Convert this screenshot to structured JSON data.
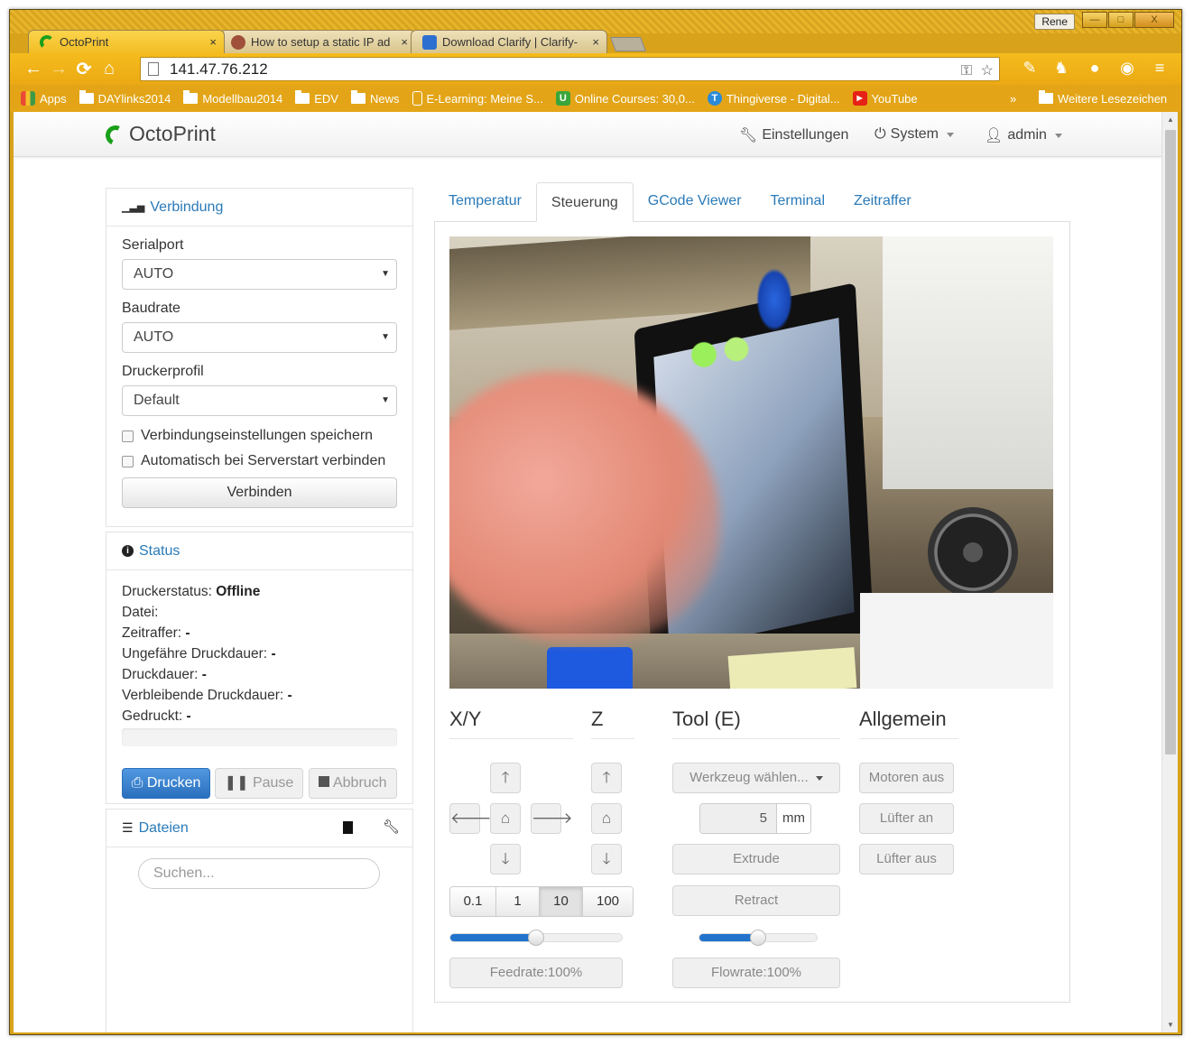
{
  "window": {
    "user": "Rene",
    "min": "—",
    "max": "□",
    "close": "X"
  },
  "browser_tabs": [
    {
      "label": "OctoPrint",
      "close": "×",
      "fav_color": "#1aa01a",
      "active": true
    },
    {
      "label": "How to setup a static IP ad",
      "close": "×",
      "fav_color": "#a0503a",
      "active": false
    },
    {
      "label": "Download Clarify | Clarify-",
      "close": "×",
      "fav_color": "#2d6fd0",
      "active": false
    }
  ],
  "omnibox": {
    "url": "141.47.76.212"
  },
  "bookmarks": [
    {
      "label": "Apps",
      "icon": "apps-grid-icon"
    },
    {
      "label": "DAYlinks2014",
      "icon": "folder-icon"
    },
    {
      "label": "Modellbau2014",
      "icon": "folder-icon"
    },
    {
      "label": "EDV",
      "icon": "folder-icon"
    },
    {
      "label": "News",
      "icon": "folder-icon"
    },
    {
      "label": "E-Learning: Meine S...",
      "icon": "page-icon"
    },
    {
      "label": "Online Courses: 30,0...",
      "icon": "udemy-icon"
    },
    {
      "label": "Thingiverse - Digital...",
      "icon": "thingiverse-icon"
    },
    {
      "label": "YouTube",
      "icon": "youtube-icon"
    }
  ],
  "bookmarks_more": "»",
  "bookmarks_other": "Weitere Lesezeichen",
  "app": {
    "brand": "OctoPrint",
    "nav": {
      "settings": "Einstellungen",
      "system": "System",
      "user": "admin"
    }
  },
  "connection": {
    "title": "Verbindung",
    "serialport_label": "Serialport",
    "serialport_value": "AUTO",
    "baudrate_label": "Baudrate",
    "baudrate_value": "AUTO",
    "profile_label": "Druckerprofil",
    "profile_value": "Default",
    "save_settings": "Verbindungseinstellungen speichern",
    "auto_connect": "Automatisch bei Serverstart verbinden",
    "connect_button": "Verbinden"
  },
  "status": {
    "title": "Status",
    "printer_status_label": "Druckerstatus:",
    "printer_status_value": "Offline",
    "file_label": "Datei:",
    "timelapse_label": "Zeitraffer:",
    "timelapse_value": "-",
    "est_time_label": "Ungefähre Druckdauer:",
    "est_time_value": "-",
    "print_time_label": "Druckdauer:",
    "print_time_value": "-",
    "remaining_label": "Verbleibende Druckdauer:",
    "remaining_value": "-",
    "printed_label": "Gedruckt:",
    "printed_value": "-",
    "print_button": "Drucken",
    "pause_button": "Pause",
    "cancel_button": "Abbruch"
  },
  "files": {
    "title": "Dateien",
    "search_placeholder": "Suchen..."
  },
  "main_tabs": [
    "Temperatur",
    "Steuerung",
    "GCode Viewer",
    "Terminal",
    "Zeitraffer"
  ],
  "control": {
    "xy_title": "X/Y",
    "z_title": "Z",
    "tool_title": "Tool (E)",
    "general_title": "Allgemein",
    "step_sizes": [
      "0.1",
      "1",
      "10",
      "100"
    ],
    "active_step": "10",
    "feedrate_label": "Feedrate:100%",
    "feedrate_fraction": 0.5,
    "tool_select": "Werkzeug wählen...",
    "extrude_amount": "5",
    "extrude_unit": "mm",
    "extrude_button": "Extrude",
    "retract_button": "Retract",
    "flowrate_label": "Flowrate:100%",
    "flowrate_fraction": 0.5,
    "motors_off": "Motoren aus",
    "fan_on": "Lüfter an",
    "fan_off": "Lüfter aus"
  }
}
